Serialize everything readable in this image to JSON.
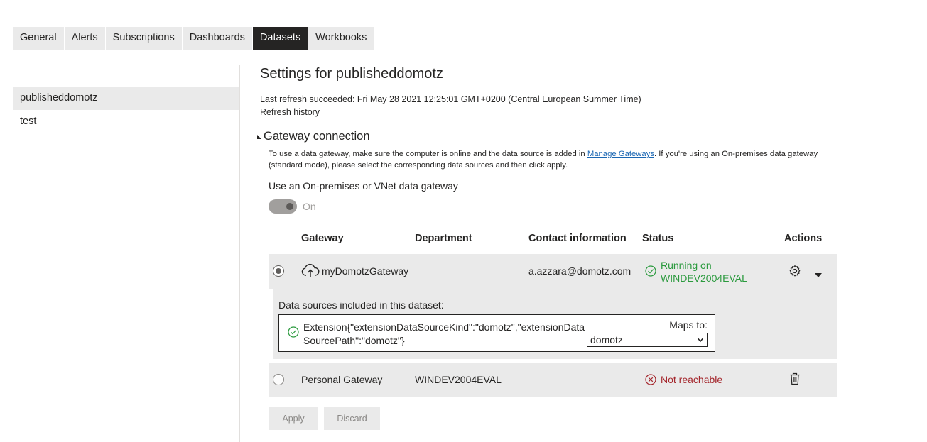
{
  "tabs": [
    {
      "label": "General"
    },
    {
      "label": "Alerts"
    },
    {
      "label": "Subscriptions"
    },
    {
      "label": "Dashboards"
    },
    {
      "label": "Datasets",
      "active": true
    },
    {
      "label": "Workbooks"
    }
  ],
  "left_list": [
    {
      "label": "publisheddomotz",
      "selected": true
    },
    {
      "label": "test"
    }
  ],
  "settings": {
    "title": "Settings for publisheddomotz",
    "refresh_status": "Last refresh succeeded: Fri May 28 2021 12:25:01 GMT+0200 (Central European Summer Time)",
    "refresh_history": "Refresh history"
  },
  "gateway": {
    "section_title": "Gateway connection",
    "desc_before": "To use a data gateway, make sure the computer is online and the data source is added in ",
    "desc_link": "Manage Gateways",
    "desc_after": ". If you're using an On-premises data gateway (standard mode), please select the corresponding data sources and then click apply.",
    "use_label": "Use an On-premises or VNet data gateway",
    "toggle_state": "On",
    "table": {
      "headers": {
        "gateway": "Gateway",
        "department": "Department",
        "contact": "Contact information",
        "status": "Status",
        "actions": "Actions"
      },
      "rows": [
        {
          "name": "myDomotzGateway",
          "department": "",
          "contact": "a.azzara@domotz.com",
          "status_line1": "Running on",
          "status_line2": "WINDEV2004EVAL",
          "selected": true
        },
        {
          "name": "Personal Gateway",
          "department": "WINDEV2004EVAL",
          "contact": "",
          "status": "Not reachable",
          "selected": false
        }
      ]
    },
    "data_sources": {
      "label": "Data sources included in this dataset:",
      "source_line1": "Extension{\"extensionDataSourceKind\":\"domotz\",\"extensionData",
      "source_line2": "SourcePath\":\"domotz\"}",
      "maps_to_label": "Maps to:",
      "maps_to_value": "domotz"
    }
  },
  "buttons": {
    "apply": "Apply",
    "discard": "Discard"
  },
  "colors": {
    "active_tab": "#252423",
    "tab_bg": "#eaeaea",
    "status_ok": "#2b9a3e",
    "status_error": "#a4262c",
    "link": "#1b67b3"
  }
}
